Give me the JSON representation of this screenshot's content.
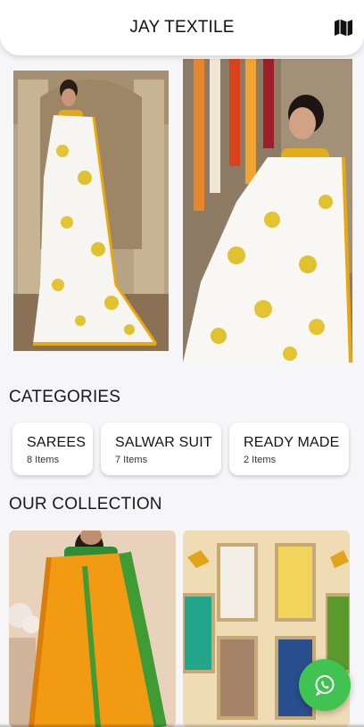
{
  "header": {
    "title": "JAY TEXTILE",
    "map_icon": "map-icon"
  },
  "banner": {
    "images": [
      {
        "name": "banner-image-saree-1",
        "colors": {
          "saree": "#f7f6f2",
          "border": "#e8a80f",
          "print": "#e2c531",
          "bg": "#b8a487"
        }
      },
      {
        "name": "banner-image-saree-2",
        "colors": {
          "saree": "#f8f7f3",
          "border": "#e8a80f",
          "print": "#e0c12e",
          "bg": "#8f7d68"
        }
      }
    ]
  },
  "categories": {
    "title": "CATEGORIES",
    "items": [
      {
        "name": "SAREES",
        "count": "8 Items"
      },
      {
        "name": "SALWAR SUIT",
        "count": "7 Items"
      },
      {
        "name": "READY MADE",
        "count": "2 Items"
      }
    ]
  },
  "collection": {
    "title": "OUR COLLECTION",
    "items": [
      {
        "name": "collection-item-orange-saree",
        "colors": {
          "saree": "#f29a12",
          "border": "#3f9b34",
          "bg": "#e9d3bd"
        }
      },
      {
        "name": "collection-item-catalog",
        "colors": {
          "bg": "#efdcb5",
          "frame": "#c7a978"
        }
      }
    ]
  },
  "fab": {
    "icon": "whatsapp-icon",
    "color": "#40c351"
  },
  "theme": {
    "background": "#f6f6f9",
    "card": "#ffffff",
    "text": "#1c1c1c"
  }
}
